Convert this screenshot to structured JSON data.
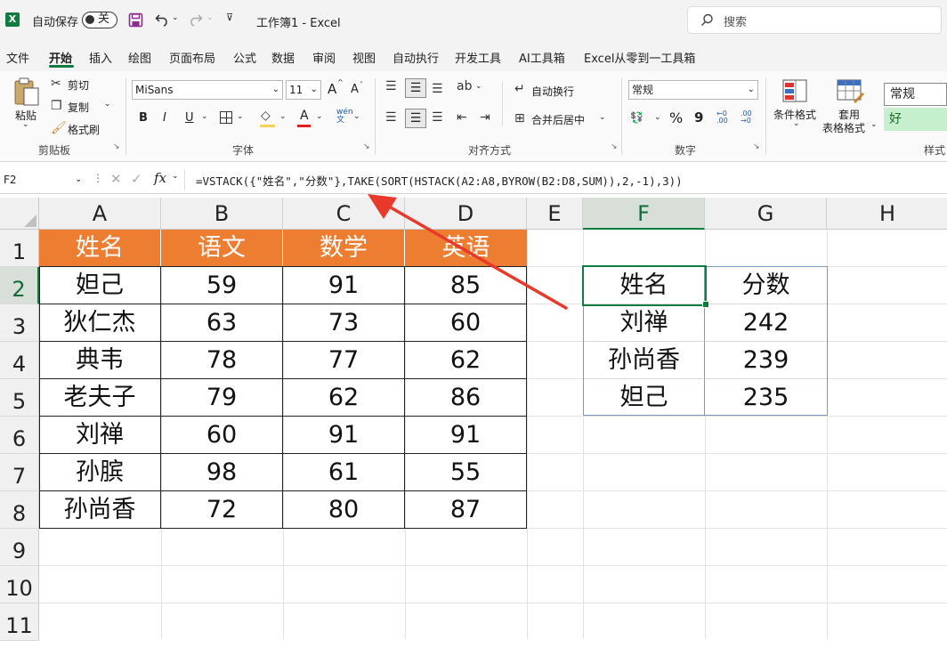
{
  "titlebar": {
    "autosave_label": "自动保存",
    "autosave_state": "关",
    "doc_title": "工作簿1  -  Excel",
    "search_placeholder": "搜索"
  },
  "menu": [
    "文件",
    "开始",
    "插入",
    "绘图",
    "页面布局",
    "公式",
    "数据",
    "审阅",
    "视图",
    "自动执行",
    "开发工具",
    "AI工具箱",
    "Excel从零到一工具箱"
  ],
  "ribbon": {
    "clipboard": {
      "paste": "粘贴",
      "cut": "剪切",
      "copy": "复制",
      "format_painter": "格式刷",
      "group": "剪贴板"
    },
    "font": {
      "name": "MiSans",
      "size": "11",
      "group": "字体",
      "bold": "B",
      "italic": "I",
      "underline": "U",
      "grow": "A",
      "shrink": "A"
    },
    "alignment": {
      "wrap": "自动换行",
      "merge": "合并后居中",
      "group": "对齐方式"
    },
    "number": {
      "format": "常规",
      "percent": "%",
      "comma": "9",
      "group": "数字"
    },
    "styles": {
      "conditional": "条件格式",
      "table_format_1": "套用",
      "table_format_2": "表格格式",
      "style_normal": "常规",
      "style_good": "好",
      "group": "样式"
    }
  },
  "formula_bar": {
    "name_box": "F2",
    "fx": "fx",
    "formula": "=VSTACK({\"姓名\",\"分数\"},TAKE(SORT(HSTACK(A2:A8,BYROW(B2:D8,SUM)),2,-1),3))"
  },
  "columns": [
    "A",
    "B",
    "C",
    "D",
    "E",
    "F",
    "G",
    "H"
  ],
  "rows": [
    "1",
    "2",
    "3",
    "4",
    "5",
    "6",
    "7",
    "8",
    "9",
    "10",
    "11"
  ],
  "source_table": {
    "headers": [
      "姓名",
      "语文",
      "数学",
      "英语"
    ],
    "rows": [
      [
        "妲己",
        "59",
        "91",
        "85"
      ],
      [
        "狄仁杰",
        "63",
        "73",
        "60"
      ],
      [
        "典韦",
        "78",
        "77",
        "62"
      ],
      [
        "老夫子",
        "79",
        "62",
        "86"
      ],
      [
        "刘禅",
        "60",
        "91",
        "91"
      ],
      [
        "孙膑",
        "98",
        "61",
        "55"
      ],
      [
        "孙尚香",
        "72",
        "80",
        "87"
      ]
    ]
  },
  "output_table": {
    "headers": [
      "姓名",
      "分数"
    ],
    "rows": [
      [
        "刘禅",
        "242"
      ],
      [
        "孙尚香",
        "239"
      ],
      [
        "妲己",
        "235"
      ]
    ]
  },
  "selected_cell": "F2",
  "colors": {
    "header_fill": "#ed7d31",
    "accent": "#107c41",
    "arrow": "#e8392b"
  }
}
